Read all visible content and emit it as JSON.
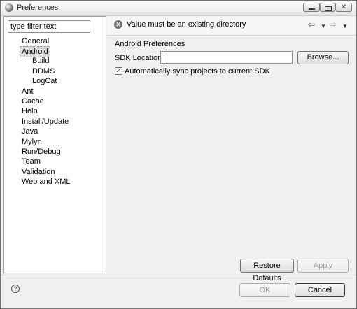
{
  "window": {
    "title": "Preferences"
  },
  "filter": {
    "value": "type filter text"
  },
  "tree": {
    "items": [
      {
        "label": "General"
      },
      {
        "label": "Android"
      },
      {
        "label": "Build"
      },
      {
        "label": "DDMS"
      },
      {
        "label": "LogCat"
      },
      {
        "label": "Ant"
      },
      {
        "label": "Cache"
      },
      {
        "label": "Help"
      },
      {
        "label": "Install/Update"
      },
      {
        "label": "Java"
      },
      {
        "label": "Mylyn"
      },
      {
        "label": "Run/Debug"
      },
      {
        "label": "Team"
      },
      {
        "label": "Validation"
      },
      {
        "label": "Web and XML"
      }
    ],
    "selected": "Android"
  },
  "header": {
    "message": "Value must be an existing directory",
    "error_icon": "x-circle-icon",
    "nav_back_icon": "⇦",
    "nav_back_menu_icon": "▼",
    "nav_forward_icon": "⇨",
    "nav_forward_menu_icon": "▼"
  },
  "page": {
    "title": "Android Preferences",
    "sdk_label": "SDK Location:",
    "sdk_value": "",
    "browse_label": "Browse...",
    "sync_label": "Automatically sync projects to current SDK",
    "sync_checked": true
  },
  "buttons": {
    "restore_defaults": "Restore Defaults",
    "apply": "Apply",
    "ok": "OK",
    "cancel": "Cancel"
  },
  "help": {
    "icon": "?"
  }
}
